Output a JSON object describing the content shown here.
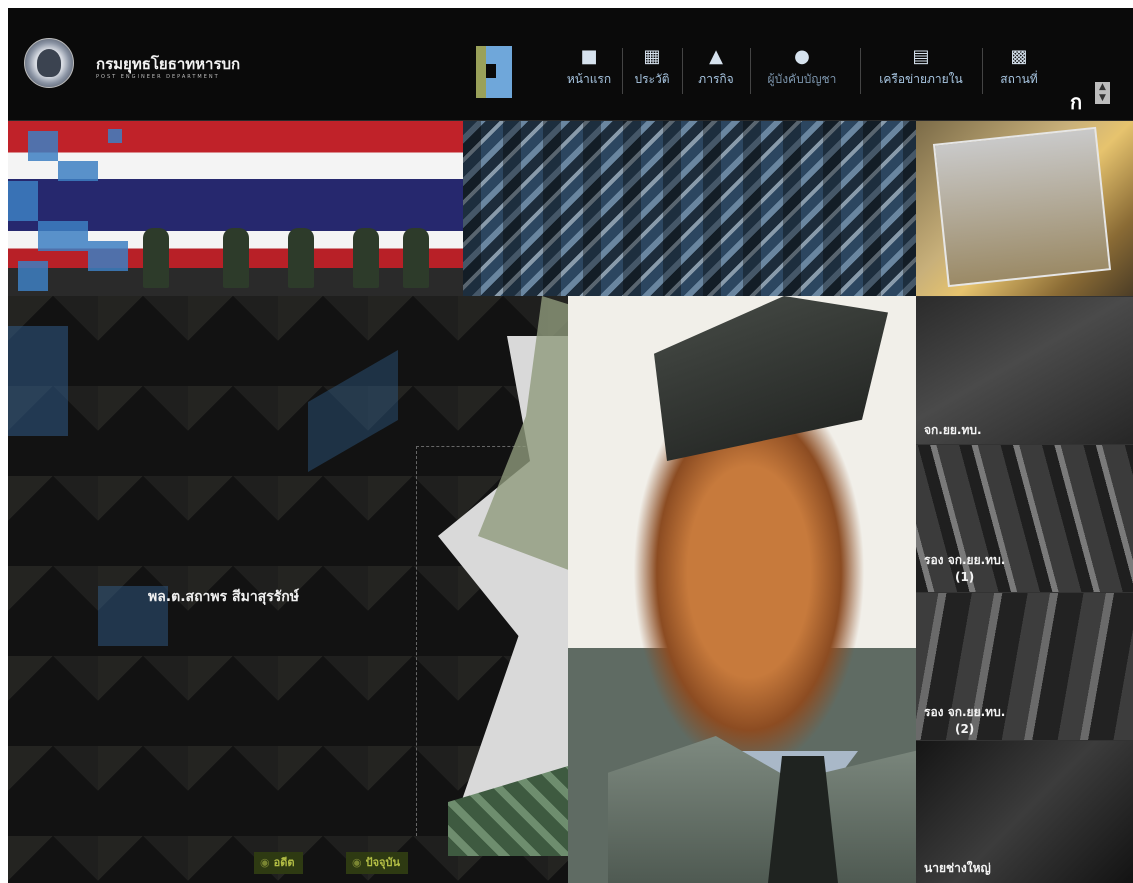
{
  "header": {
    "org_name_th": "กรมยุทธโยธาทหารบก",
    "org_name_en": "POST ENGINEER DEPARTMENT",
    "font_toggle": "ก",
    "nav": [
      {
        "label": "หน้าแรก",
        "icon": "building-icon"
      },
      {
        "label": "ประวัติ",
        "icon": "book-icon"
      },
      {
        "label": "ภารกิจ",
        "icon": "house-icon"
      },
      {
        "label": "ผู้บังคับบัญชา",
        "icon": "officer-cap-icon",
        "active": true
      },
      {
        "label": "เครือข่ายภายใน",
        "icon": "network-icon"
      },
      {
        "label": "สถานที่",
        "icon": "location-building-icon"
      }
    ]
  },
  "main": {
    "commander_name": "พล.ต.สถาพร สีมาสุรรักษ์",
    "history_buttons": [
      {
        "label": "อดีต"
      },
      {
        "label": "ปัจจุบัน"
      }
    ]
  },
  "sidebar": {
    "panels": [
      {
        "label": "จก.ยย.ทบ.",
        "sub": ""
      },
      {
        "label": "รอง จก.ยย.ทบ.",
        "sub": "(1)"
      },
      {
        "label": "รอง จก.ยย.ทบ.",
        "sub": "(2)"
      },
      {
        "label": "นายช่างใหญ่",
        "sub": ""
      }
    ]
  },
  "colors": {
    "nav_text": "#a9c7e3",
    "accent_blue": "#6fa7da",
    "button_text": "#b3be45"
  }
}
